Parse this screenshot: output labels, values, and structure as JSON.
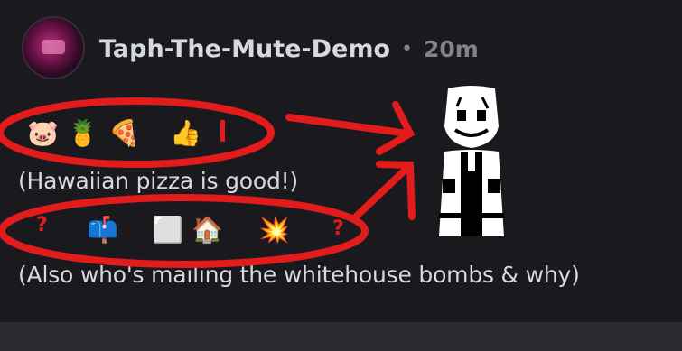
{
  "post": {
    "username": "Taph-The-Mute-Demo",
    "separator": "•",
    "timestamp": "20m"
  },
  "line1": {
    "emojis": [
      "🐷",
      "🍍",
      "🍕",
      "👍"
    ],
    "caption": "(Hawaiian pizza is good!)"
  },
  "line2": {
    "emojis": [
      "📫",
      "⬜",
      "🏠",
      "💥"
    ],
    "caption": "(Also who's mailing the whitehouse bombs & why)"
  },
  "colors": {
    "background": "#1a1a1e",
    "annotation": "#e21b1b",
    "footer": "#2a2a2e"
  },
  "icons": [
    "avatar-image",
    "gaster-sprite",
    "question-mark-icon"
  ]
}
